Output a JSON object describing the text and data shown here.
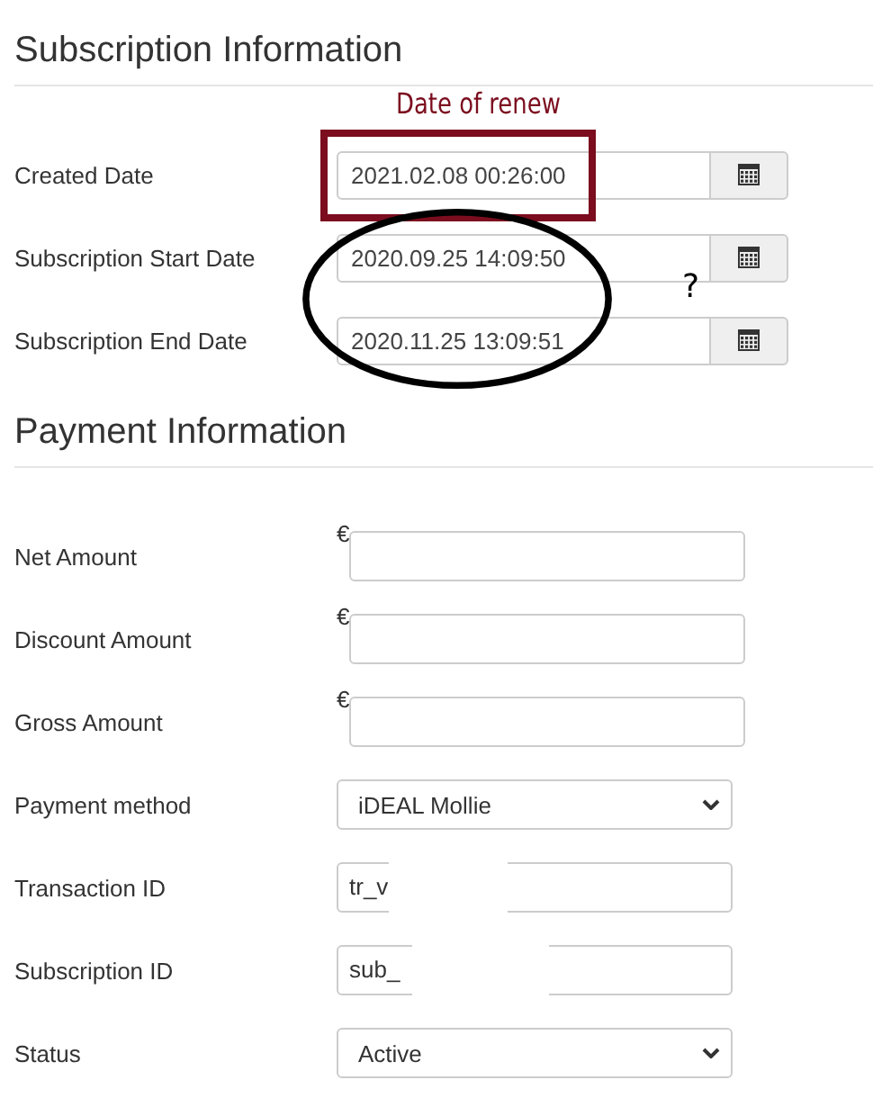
{
  "sections": [
    {
      "title": "Subscription Information",
      "fields": [
        {
          "label": "Created Date",
          "kind": "date",
          "value": "2021.02.08 00:26:00"
        },
        {
          "label": "Subscription Start Date",
          "kind": "date",
          "value": "2020.09.25 14:09:50"
        },
        {
          "label": "Subscription End Date",
          "kind": "date",
          "value": "2020.11.25 13:09:51"
        }
      ]
    },
    {
      "title": "Payment Information",
      "fields": [
        {
          "label": "Net Amount",
          "kind": "amount",
          "currency": "€"
        },
        {
          "label": "Discount Amount",
          "kind": "amount",
          "currency": "€"
        },
        {
          "label": "Gross Amount",
          "kind": "amount",
          "currency": "€"
        },
        {
          "label": "Payment method",
          "kind": "select",
          "value": "iDEAL Mollie"
        },
        {
          "label": "Transaction ID",
          "kind": "redacted",
          "value": "tr_v"
        },
        {
          "label": "Subscription ID",
          "kind": "redacted",
          "value": "sub_"
        },
        {
          "label": "Status",
          "kind": "select",
          "value": "Active"
        }
      ]
    }
  ],
  "annotations": [
    {
      "kind": "label",
      "text": "Date of renew",
      "color": "#7b0d1e"
    },
    {
      "kind": "box",
      "color": "#7b0d1e"
    },
    {
      "kind": "ellipse",
      "color": "#000000"
    },
    {
      "kind": "label",
      "text": "?",
      "color": "#000000"
    }
  ]
}
